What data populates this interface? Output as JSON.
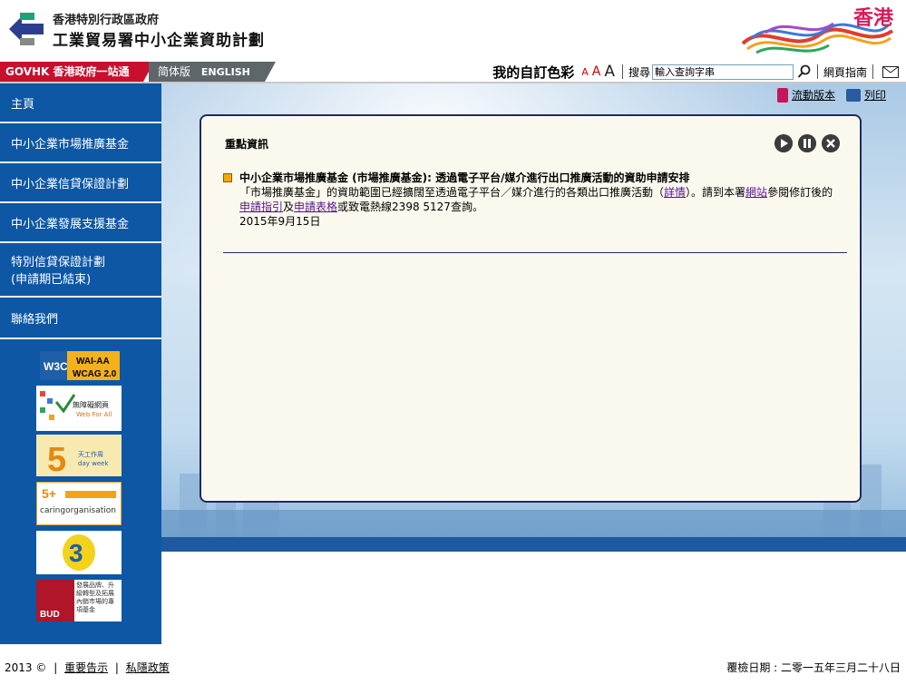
{
  "header": {
    "dept_line1": "香港特別行政區政府",
    "dept_line2": "工業貿易署中小企業資助計劃",
    "brand": "香港"
  },
  "topbar": {
    "govhk": "GOVHK 香港政府一站通",
    "simplified": "简体版",
    "english": "ENGLISH",
    "color_setting": "我的自訂色彩",
    "font_sizes": [
      "A",
      "A",
      "A"
    ],
    "search_label": "搜尋",
    "search_placeholder": "輸入查詢字串",
    "sitemap": "網頁指南"
  },
  "sidebar": {
    "items": [
      {
        "label": "主頁"
      },
      {
        "label": "中小企業市場推廣基金"
      },
      {
        "label": "中小企業信貸保證計劃"
      },
      {
        "label": "中小企業發展支援基金"
      },
      {
        "label": "特別信貸保證計劃\n(申請期已結束)"
      },
      {
        "label": "聯絡我們"
      }
    ],
    "badges": {
      "wcag_top": "WAI-AA",
      "wcag_bottom": "WCAG 2.0",
      "web_for_all_1": "無障礙網頁",
      "web_for_all_2": "Web For All",
      "five_day_1": "天工作周",
      "five_day_2": "day week",
      "caring": "caringorganisation",
      "bud_label": "BUD",
      "bud_text": "發展品牌、升級轉型及拓展內銷市場的專項基金"
    }
  },
  "main": {
    "mobile_version": "流動版本",
    "print": "列印",
    "panel_title": "重點資訊",
    "news": {
      "title": "中小企業市場推廣基金 (市場推廣基金): 透過電子平台/媒介進行出口推廣活動的資助申請安排",
      "text_1": "「市場推廣基金」的資助範圍已經擴闊至透過電子平台／媒介進行的各類出口推廣活動（",
      "link_details": "詳情",
      "text_2": "）。請到本署",
      "link_website": "網站",
      "text_3": "參閱修訂後的",
      "link_guide": "申請指引",
      "text_4": "及",
      "link_form": "申請表格",
      "text_5": "或致電熱線2398 5127查詢。",
      "date": "2015年9月15日"
    }
  },
  "footer": {
    "copyright": "2013 ©",
    "notice": "重要告示",
    "privacy": "私隱政策",
    "review": "覆檢日期 : 二零一五年三月二十八日"
  },
  "colors": {
    "sidebar": "#0d57a5",
    "govhk": "#c8102e",
    "panel_border": "#222a58",
    "bullet": "#f5a800"
  }
}
